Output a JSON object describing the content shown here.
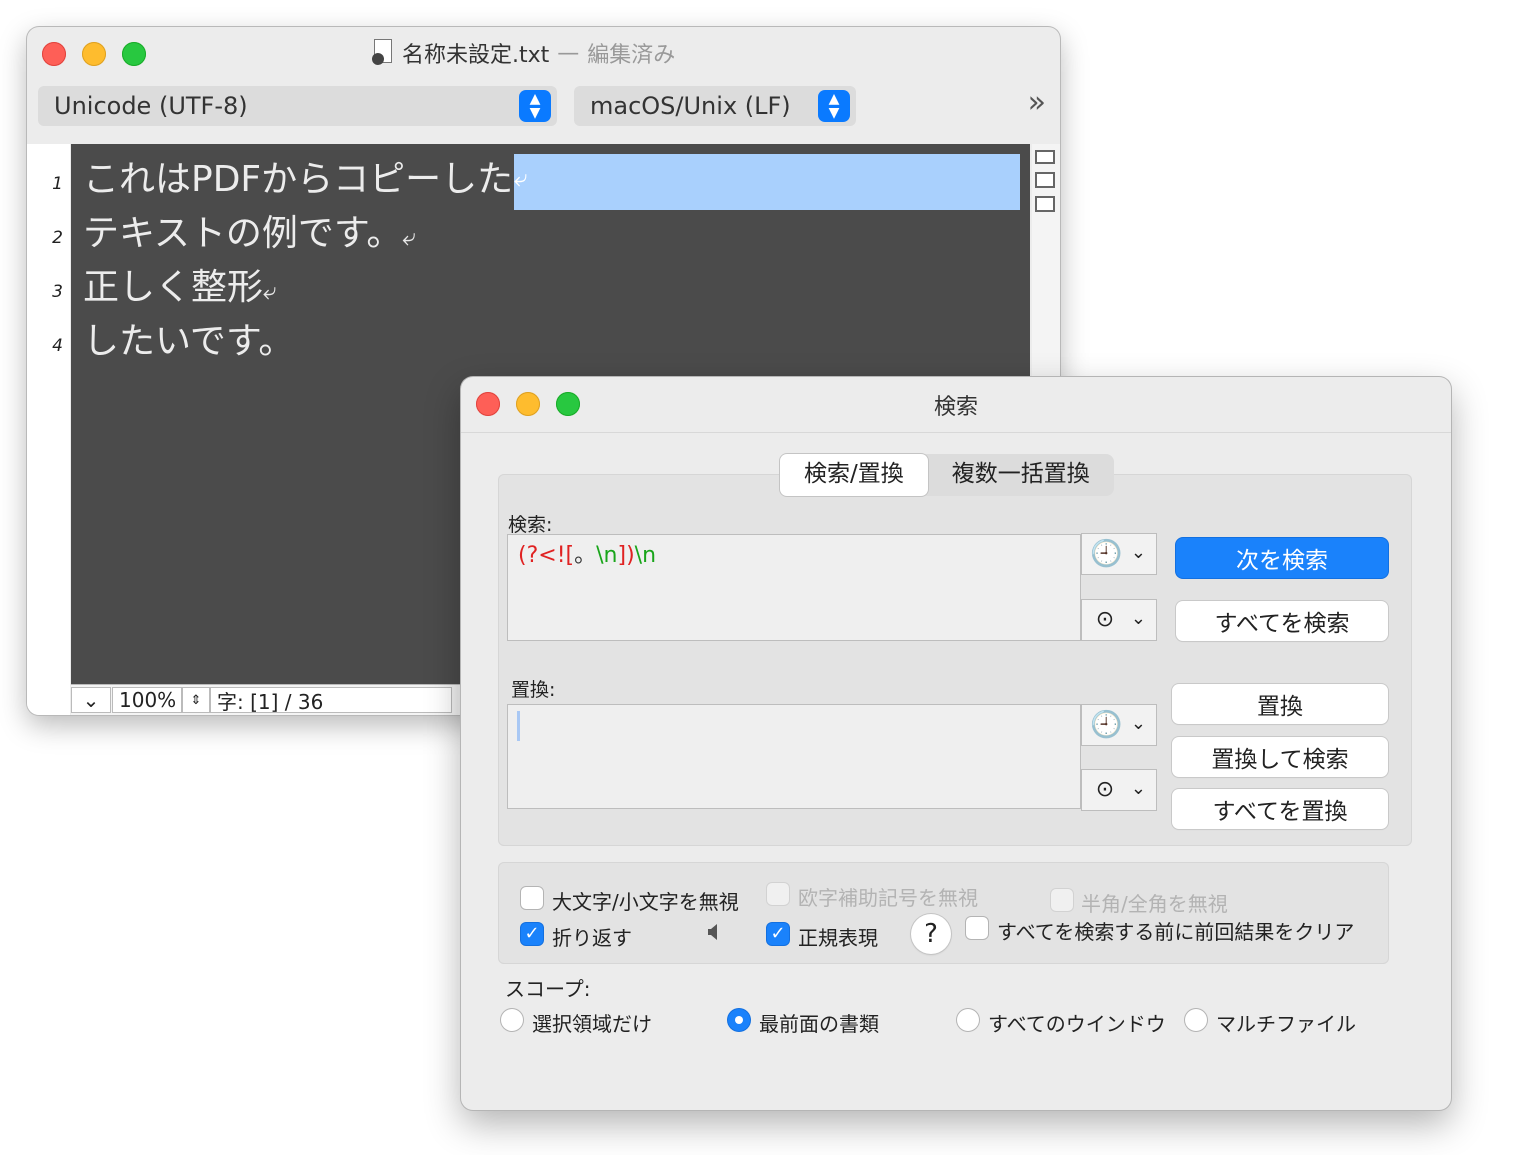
{
  "editor": {
    "filename": "名称未設定.txt",
    "separator": "—",
    "status": "編集済み",
    "encoding": "Unicode (UTF-8)",
    "line_endings": "macOS/Unix (LF)",
    "toolbar_more": "»",
    "line_numbers": [
      "1",
      "2",
      "3",
      "4"
    ],
    "lines": [
      "これはPDFからコピーした",
      "テキストの例です。",
      "正しく整形",
      "したいです。"
    ],
    "newline_glyph": "⤶",
    "zoom": "100%",
    "char_count": "字: [1] / 36"
  },
  "find_dialog": {
    "title": "検索",
    "tabs": [
      "検索/置換",
      "複数一括置換"
    ],
    "active_tab": 0,
    "search_label": "検索:",
    "search_value": {
      "part1": "(?<![",
      "part2": "。",
      "part3": "\\n",
      "part4": "])",
      "part5": "\\n"
    },
    "replace_label": "置換:",
    "replace_value": "",
    "buttons": {
      "find_next": "次を検索",
      "find_all": "すべてを検索",
      "replace": "置換",
      "replace_and_find": "置換して検索",
      "replace_all": "すべてを置換"
    },
    "options": {
      "ignore_case": {
        "label": "大文字/小文字を無視",
        "checked": false
      },
      "ignore_diacritics": {
        "label": "欧字補助記号を無視",
        "checked": false,
        "disabled": true
      },
      "ignore_width": {
        "label": "半角/全角を無視",
        "checked": false,
        "disabled": true
      },
      "wrap": {
        "label": "折り返す",
        "checked": true
      },
      "regex": {
        "label": "正規表現",
        "checked": true
      },
      "clear_results": {
        "label": "すべてを検索する前に前回結果をクリア",
        "checked": false
      }
    },
    "help_label": "?",
    "scope_label": "スコープ:",
    "scope_options": [
      "選択領域だけ",
      "最前面の書類",
      "すべてのウインドウ",
      "マルチファイル"
    ],
    "scope_selected": 1
  },
  "colors": {
    "accent": "#1a82fb",
    "selection": "#a9d0fd",
    "editor_bg": "#4b4b4b",
    "regex_red": "#e02222",
    "regex_green": "#19a51a"
  }
}
